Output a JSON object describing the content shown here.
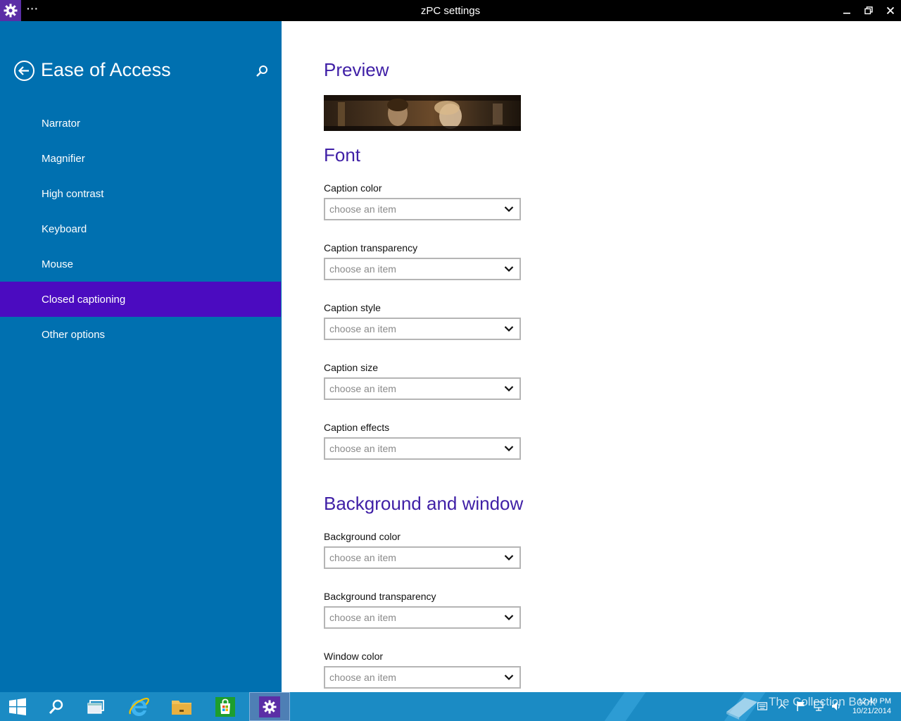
{
  "window": {
    "title": "zPC settings",
    "dots": "···"
  },
  "sidebar": {
    "title": "Ease of Access",
    "items": [
      {
        "label": "Narrator",
        "active": false
      },
      {
        "label": "Magnifier",
        "active": false
      },
      {
        "label": "High contrast",
        "active": false
      },
      {
        "label": "Keyboard",
        "active": false
      },
      {
        "label": "Mouse",
        "active": false
      },
      {
        "label": "Closed captioning",
        "active": true
      },
      {
        "label": "Other options",
        "active": false
      }
    ]
  },
  "main": {
    "preview_heading": "Preview",
    "font_heading": "Font",
    "background_heading": "Background and window",
    "fields": [
      {
        "label": "Caption color",
        "value": "choose an item"
      },
      {
        "label": "Caption transparency",
        "value": "choose an item"
      },
      {
        "label": "Caption style",
        "value": "choose an item"
      },
      {
        "label": "Caption size",
        "value": "choose an item"
      },
      {
        "label": "Caption effects",
        "value": "choose an item"
      },
      {
        "label": "Background color",
        "value": "choose an item"
      },
      {
        "label": "Background transparency",
        "value": "choose an item"
      },
      {
        "label": "Window color",
        "value": "choose an item"
      }
    ]
  },
  "taskbar": {
    "watermark": "The Collection Book",
    "time": "12:49 PM",
    "date": "10/21/2014",
    "buttons": [
      "start-icon",
      "search-icon",
      "task-view-icon",
      "internet-explorer-icon",
      "file-explorer-icon",
      "store-icon",
      "settings-icon"
    ]
  },
  "colors": {
    "sidebar_bg": "#0070b0",
    "accent": "#4b0bc0",
    "heading": "#3f1fa6",
    "taskbar": "#1b8bc4"
  }
}
